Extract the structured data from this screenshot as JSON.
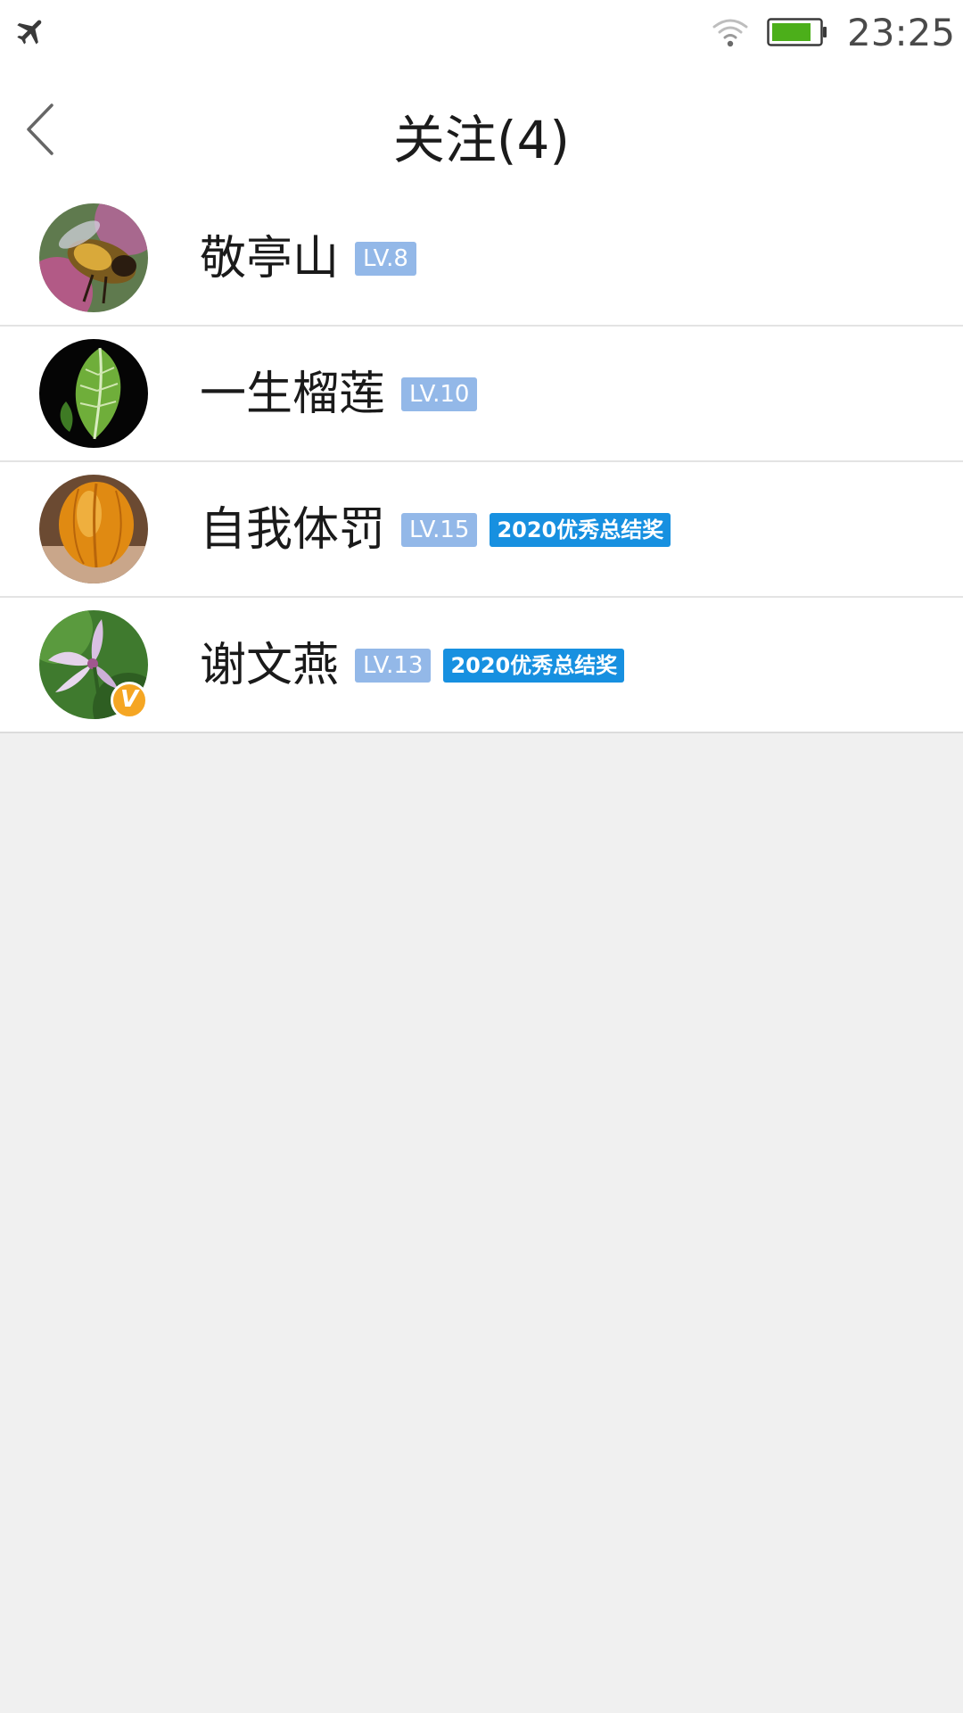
{
  "status_bar": {
    "time": "23:25",
    "airplane_icon": "airplane-icon",
    "wifi_icon": "wifi-icon",
    "battery_icon": "battery-icon",
    "battery_color": "#4caf1a"
  },
  "nav": {
    "back_icon": "chevron-left-icon",
    "title": "关注(4)"
  },
  "colors": {
    "level_badge": "#93b8e8",
    "award_badge": "#1790e0",
    "verified_badge": "#f5a623",
    "background": "#f0f0f0"
  },
  "following": [
    {
      "name": "敬亭山",
      "level": "LV.8",
      "award": "",
      "verified": false,
      "avatar": "bee-on-flower"
    },
    {
      "name": "一生榴莲",
      "level": "LV.10",
      "award": "",
      "verified": false,
      "avatar": "green-leaf"
    },
    {
      "name": "自我体罚",
      "level": "LV.15",
      "award": "2020优秀总结奖",
      "verified": false,
      "avatar": "orange-fruit"
    },
    {
      "name": "谢文燕",
      "level": "LV.13",
      "award": "2020优秀总结奖",
      "verified": true,
      "verified_label": "V",
      "avatar": "purple-orchid"
    }
  ]
}
